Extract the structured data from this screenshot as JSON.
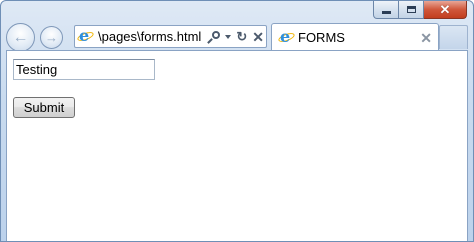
{
  "browser": {
    "address": "\\pages\\forms.html",
    "tab_title": "FORMS",
    "icons": {
      "back": "back-arrow-icon",
      "forward": "forward-arrow-icon",
      "search": "search-icon",
      "dropdown": "chevron-down-icon",
      "refresh": "refresh-icon",
      "stop": "close-icon",
      "tab_close": "close-icon"
    },
    "glyphs": {
      "back": "←",
      "forward": "→",
      "refresh": "↻",
      "stop": "✕",
      "tab_close": "✕",
      "window_close": "✕"
    }
  },
  "form": {
    "text_value": "Testing",
    "submit_label": "Submit"
  },
  "colors": {
    "frame": "#c9dbef",
    "close_button": "#c23d1e",
    "ie_blue": "#2f8fdc"
  }
}
